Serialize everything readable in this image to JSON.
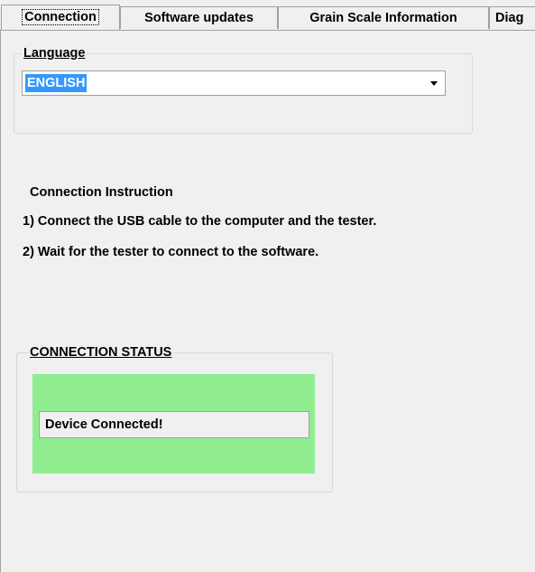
{
  "tabs": [
    {
      "label": "Connection",
      "active": true
    },
    {
      "label": "Software updates",
      "active": false
    },
    {
      "label": "Grain Scale Information",
      "active": false
    },
    {
      "label": "Diag",
      "active": false
    }
  ],
  "language": {
    "title": "Language",
    "selected": "ENGLISH"
  },
  "instructions": {
    "heading": "Connection Instruction",
    "step1": "1) Connect the USB cable to the computer and the tester.",
    "step2": "2) Wait for the tester to connect to the software."
  },
  "status": {
    "title": "CONNECTION STATUS",
    "message": "Device Connected!",
    "panel_color": "#90ee90"
  },
  "icons": {
    "dropdown": "chevron-down-icon"
  }
}
